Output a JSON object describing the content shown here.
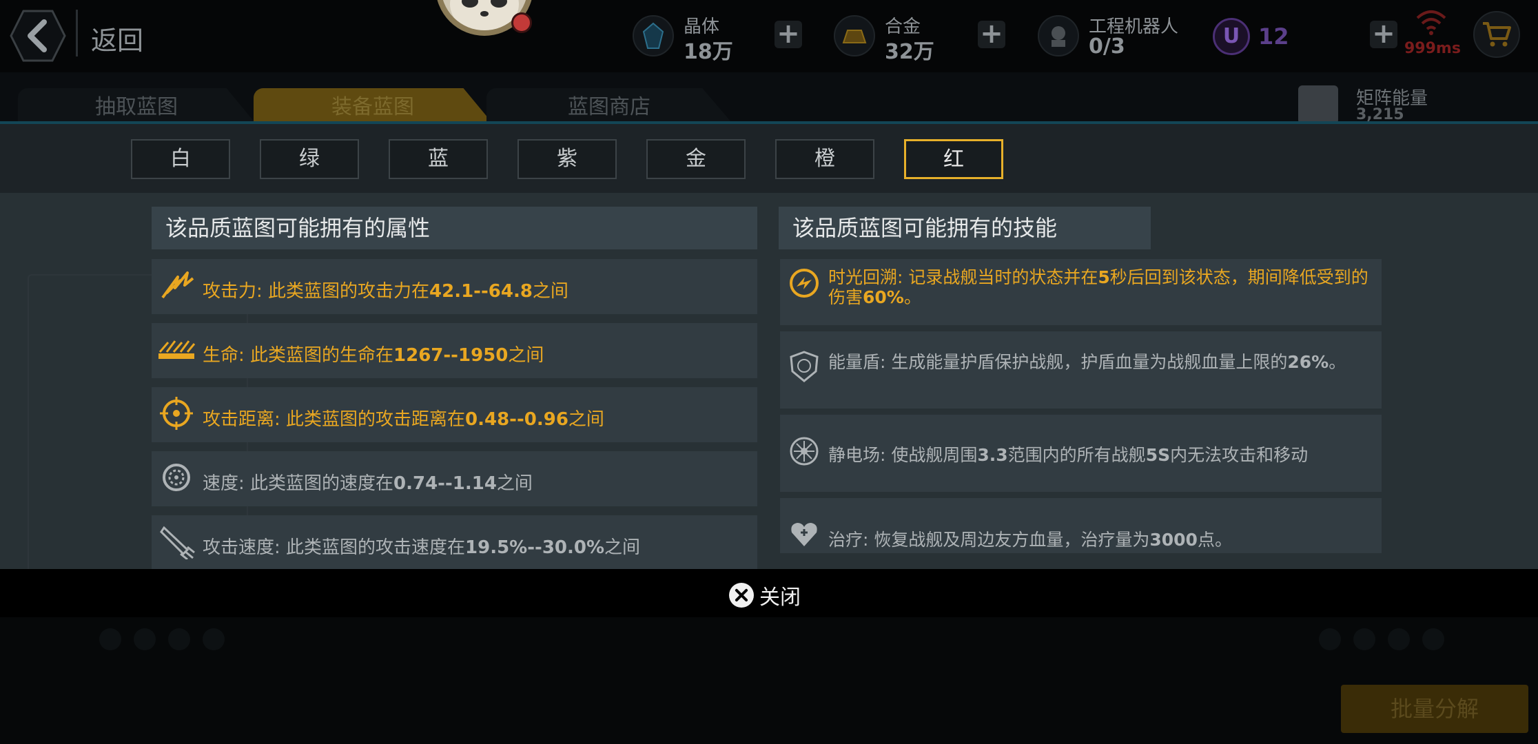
{
  "header": {
    "back_label": "返回",
    "resources": [
      {
        "name": "晶体",
        "value": "18万",
        "icon": "crystal-icon"
      },
      {
        "name": "合金",
        "value": "32万",
        "icon": "alloy-icon"
      },
      {
        "name": "工程机器人",
        "value": "0/3",
        "icon": "robot-icon"
      }
    ],
    "u_icon_letter": "U",
    "u_value": "12",
    "ping": "999ms"
  },
  "tabs": [
    {
      "label": "抽取蓝图",
      "active": false
    },
    {
      "label": "装备蓝图",
      "active": true
    },
    {
      "label": "蓝图商店",
      "active": false
    }
  ],
  "matrix": {
    "name": "矩阵能量",
    "value": "3,215"
  },
  "qualities": [
    {
      "label": "白",
      "selected": false
    },
    {
      "label": "绿",
      "selected": false
    },
    {
      "label": "蓝",
      "selected": false
    },
    {
      "label": "紫",
      "selected": false
    },
    {
      "label": "金",
      "selected": false
    },
    {
      "label": "橙",
      "selected": false
    },
    {
      "label": "红",
      "selected": true
    }
  ],
  "attributes_title": "该品质蓝图可能拥有的属性",
  "skills_title": "该品质蓝图可能拥有的技能",
  "attributes": [
    {
      "icon": "attack-icon",
      "color": "#e9a721",
      "prefix": "攻击力: 此类蓝图的攻击力在",
      "num": "42.1--64.8",
      "suffix": "之间"
    },
    {
      "icon": "life-icon",
      "color": "#e9a721",
      "prefix": "生命: 此类蓝图的生命在",
      "num": "1267--1950",
      "suffix": "之间"
    },
    {
      "icon": "range-icon",
      "color": "#e9a721",
      "prefix": "攻击距离: 此类蓝图的攻击距离在",
      "num": "0.48--0.96",
      "suffix": "之间"
    },
    {
      "icon": "speed-icon",
      "color": "#aeb3b6",
      "prefix": "速度: 此类蓝图的速度在",
      "num": "0.74--1.14",
      "suffix": "之间"
    },
    {
      "icon": "attack-speed-icon",
      "color": "#aeb3b6",
      "prefix": "攻击速度: 此类蓝图的攻击速度在",
      "num": "19.5%--30.0%",
      "suffix": "之间"
    }
  ],
  "skills": [
    {
      "icon": "time-rewind-icon",
      "color": "#e9a721",
      "parts": [
        {
          "t": "时光回溯: 记录战舰当时的状态并在",
          "b": false
        },
        {
          "t": "5",
          "b": true
        },
        {
          "t": "秒后回到该状态，期间降低受到的伤害",
          "b": false
        },
        {
          "t": "60%",
          "b": true
        },
        {
          "t": "。",
          "b": false
        }
      ]
    },
    {
      "icon": "energy-shield-icon",
      "color": "#aeb3b6",
      "parts": [
        {
          "t": "能量盾: 生成能量护盾保护战舰，护盾血量为战舰血量上限的",
          "b": false
        },
        {
          "t": "26%",
          "b": true
        },
        {
          "t": "。",
          "b": false
        }
      ]
    },
    {
      "icon": "static-field-icon",
      "color": "#aeb3b6",
      "parts": [
        {
          "t": "静电场: 使战舰周围",
          "b": false
        },
        {
          "t": "3.3",
          "b": true
        },
        {
          "t": "范围内的所有战舰",
          "b": false
        },
        {
          "t": "5S",
          "b": true
        },
        {
          "t": "内无法攻击和移动",
          "b": false
        }
      ]
    },
    {
      "icon": "heal-icon",
      "color": "#aeb3b6",
      "parts": [
        {
          "t": "治疗: 恢复战舰及周边友方血量，治疗量为",
          "b": false
        },
        {
          "t": "3000",
          "b": true
        },
        {
          "t": "点。",
          "b": false
        }
      ]
    }
  ],
  "close_label": "关闭",
  "batch_label": "批量分解",
  "colors": {
    "accent_gold": "#e9a721",
    "selected_border": "#e7b02a",
    "panel": "#283135",
    "card": "#323c42"
  }
}
